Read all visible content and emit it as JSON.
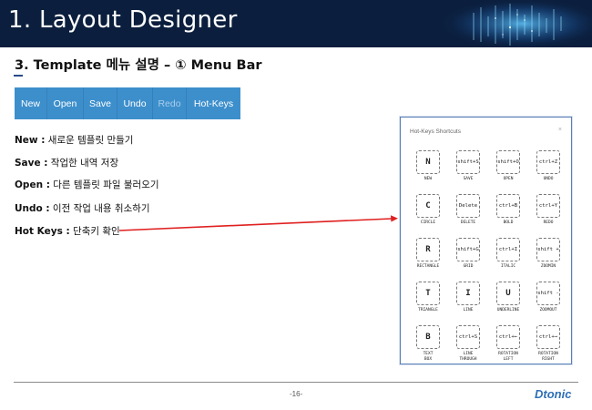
{
  "header": {
    "title": "1. Layout Designer"
  },
  "section": {
    "heading": "3.  Template 메뉴 설명 – ① Menu Bar"
  },
  "menubar": {
    "items": [
      {
        "label": "New",
        "enabled": true
      },
      {
        "label": "Open",
        "enabled": true
      },
      {
        "label": "Save",
        "enabled": true
      },
      {
        "label": "Undo",
        "enabled": true
      },
      {
        "label": "Redo",
        "enabled": false
      },
      {
        "label": "Hot-Keys",
        "enabled": true
      }
    ],
    "color": "#3d8fcc"
  },
  "descriptions": [
    {
      "key": "New :",
      "text": " 새로운 템플릿 만들기"
    },
    {
      "key": "Save :",
      "text": " 작업한 내역 저장"
    },
    {
      "key": "Open :",
      "text": " 다른 템플릿 파일 불러오기"
    },
    {
      "key": "Undo :",
      "text": " 이전 작업 내용 취소하기"
    },
    {
      "key": "Hot Keys :",
      "text": " 단축키 확인"
    }
  ],
  "shortcuts_panel": {
    "title": "Hot-Keys Shortcuts",
    "close": "×",
    "items": [
      {
        "key": "N",
        "label": "NEW"
      },
      {
        "key": "shift+S",
        "label": "SAVE"
      },
      {
        "key": "shift+O",
        "label": "OPEN"
      },
      {
        "key": "ctrl+Z",
        "label": "UNDO"
      },
      {
        "key": "C",
        "label": "CIRCLE"
      },
      {
        "key": "Delete",
        "label": "DELETE"
      },
      {
        "key": "ctrl+B",
        "label": "BOLD"
      },
      {
        "key": "ctrl+Y",
        "label": "REDO"
      },
      {
        "key": "R",
        "label": "RECTANGLE"
      },
      {
        "key": "shift+G",
        "label": "GRID"
      },
      {
        "key": "ctrl+I",
        "label": "ITALIC"
      },
      {
        "key": "shift +",
        "label": "ZOOMIN"
      },
      {
        "key": "T",
        "label": "TRIANGLE"
      },
      {
        "key": "I",
        "label": "LINE"
      },
      {
        "key": "U",
        "label": "UNDERLINE"
      },
      {
        "key": "shift -",
        "label": "ZOOMOUT"
      },
      {
        "key": "B",
        "label": "TEXT\nBOX"
      },
      {
        "key": "ctrl+S",
        "label": "LINE\nTHROUGH"
      },
      {
        "key": "ctrl+←",
        "label": "ROTATION\nLEFT"
      },
      {
        "key": "ctrl+→",
        "label": "ROTATION\nRIGHT"
      }
    ]
  },
  "footer": {
    "page": "-16-",
    "logo": "Dtonic"
  },
  "colors": {
    "banner": "#0b1e3d",
    "arrow": "#e02020",
    "logo": "#2f6fb8"
  }
}
